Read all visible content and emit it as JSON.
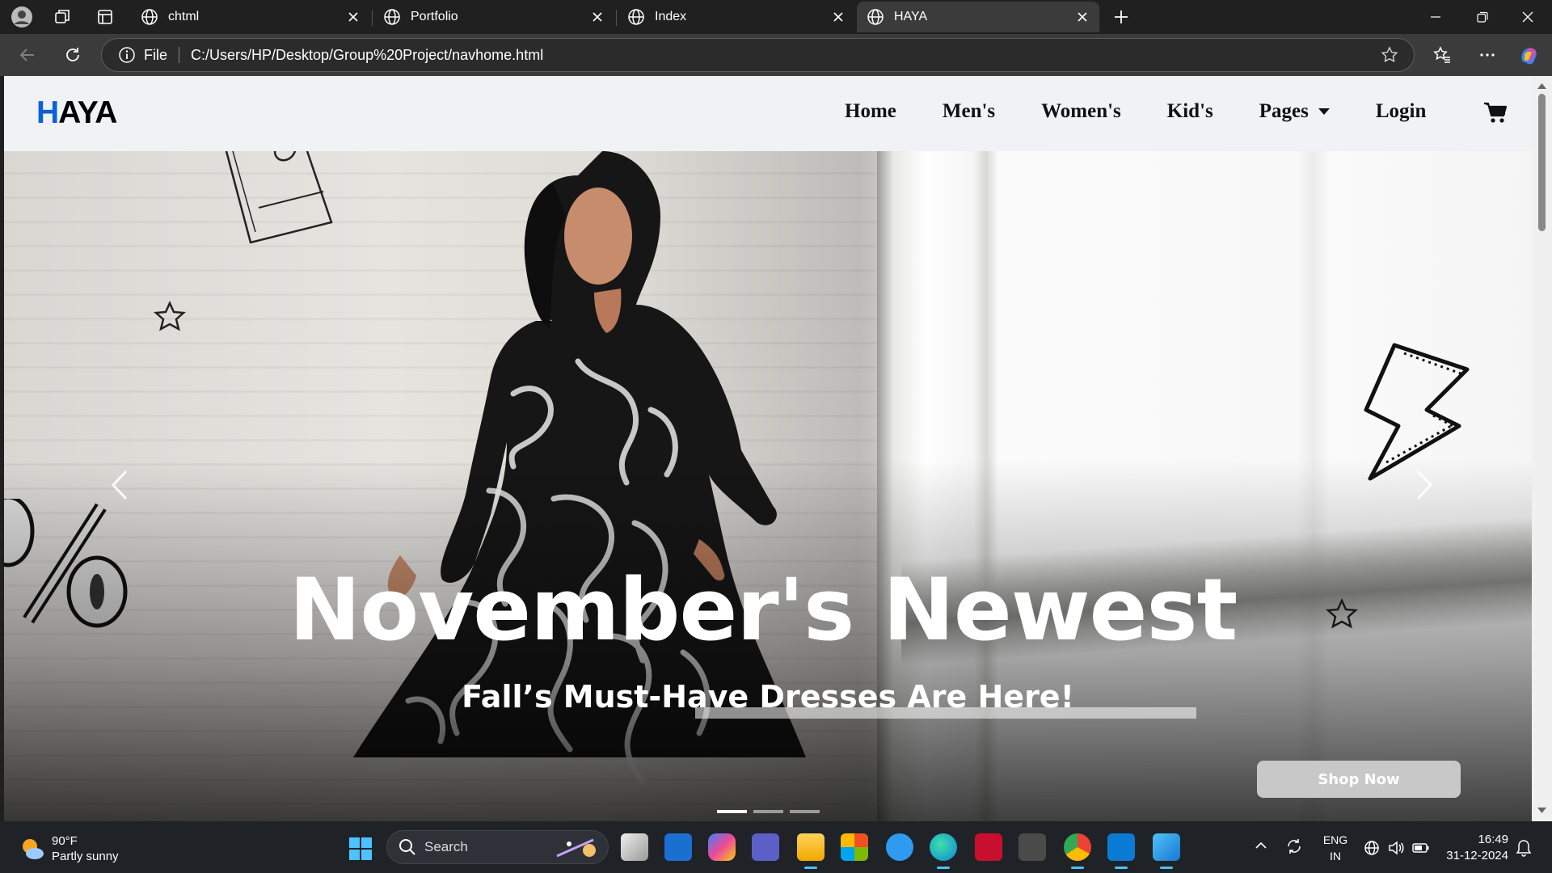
{
  "browser": {
    "tabs": [
      {
        "title": "chtml",
        "active": false
      },
      {
        "title": "Portfolio",
        "active": false
      },
      {
        "title": "Index",
        "active": false
      },
      {
        "title": "HAYA",
        "active": true
      }
    ],
    "address": {
      "scheme_label": "File",
      "url": "C:/Users/HP/Desktop/Group%20Project/navhome.html"
    }
  },
  "site": {
    "logo_first": "H",
    "logo_rest": "AYA",
    "menu": [
      "Home",
      "Men's",
      "Women's",
      "Kid's",
      "Pages",
      "Login"
    ],
    "hero": {
      "title": "November's Newest",
      "subtitle": "Fall’s Must-Have Dresses Are Here!",
      "cta": "Shop Now",
      "slides": 3,
      "active_slide": 1
    }
  },
  "taskbar": {
    "weather_temp": "90°F",
    "weather_desc": "Partly sunny",
    "search_label": "Search",
    "lang_1": "ENG",
    "lang_2": "IN",
    "time": "16:49",
    "date": "31-12-2024"
  },
  "colors": {
    "logo_accent": "#0b62d6",
    "nav_bg": "#f0f2f5",
    "chrome_bg": "#202020"
  }
}
